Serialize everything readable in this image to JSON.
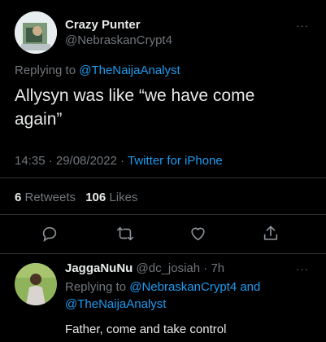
{
  "tweet": {
    "author_name": "Crazy Punter",
    "author_handle": "@NebraskanCrypt4",
    "replying_prefix": "Replying to ",
    "replying_to": "@TheNaijaAnalyst",
    "text_line1": "Allysyn was like “we have come",
    "text_line2": "again”",
    "time_date": "14:35 · 29/08/2022 · ",
    "source": "Twitter for iPhone",
    "retweets_count": "6",
    "retweets_label": " Retweets",
    "likes_count": "106",
    "likes_label": " Likes",
    "more": "···"
  },
  "actions": [
    "reply-icon",
    "retweet-icon",
    "like-icon",
    "share-icon"
  ],
  "reply": {
    "author_name": "JaggaNuNu",
    "author_handle": "@dc_josiah",
    "age": "· 7h",
    "replying_prefix": "Replying to ",
    "replying_to_1": "@NebraskanCrypt4",
    "and_word": " and",
    "replying_to_2": "@TheNaijaAnalyst",
    "text": "Father, come and take control",
    "more": "···"
  },
  "colors": {
    "background": "#000000",
    "text": "#e7e9ea",
    "muted": "#71767b",
    "accent": "#1d9bf0",
    "divider": "#2f3336"
  }
}
